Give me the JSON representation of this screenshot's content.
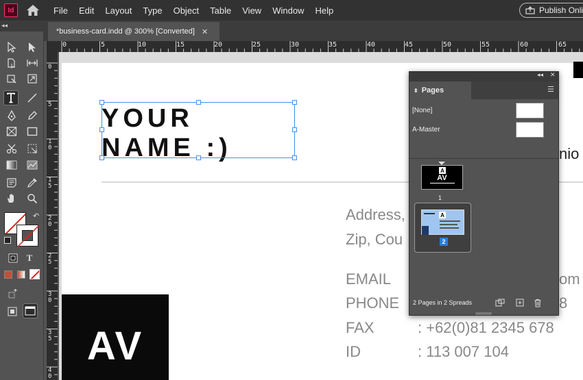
{
  "app": {
    "logo": "Id"
  },
  "menu": {
    "items": [
      "File",
      "Edit",
      "Layout",
      "Type",
      "Object",
      "Table",
      "View",
      "Window",
      "Help"
    ],
    "publish_label": "Publish Onlin"
  },
  "document": {
    "tab_title": "*business-card.indd @ 300% [Converted]",
    "tab_close": "✕"
  },
  "rulers": {
    "horizontal": [
      "0",
      "5",
      "10",
      "15",
      "20",
      "25",
      "30",
      "35",
      "40",
      "45",
      "50",
      "55",
      "60",
      "65"
    ],
    "vertical": [
      "0",
      "5",
      "10",
      "15",
      "20",
      "25",
      "30",
      "35",
      "40"
    ]
  },
  "card": {
    "name_line1": "YOUR",
    "name_line2": "NAME :)",
    "partial_right": "nio",
    "address1": "Address,",
    "address2": "Zip, Cou",
    "email_label": "EMAIL",
    "email_value": "om",
    "phone_label": "PHONE",
    "phone_value": "8",
    "fax_label": "FAX",
    "fax_value": ": +62(0)81 2345 678",
    "id_label": "ID",
    "id_value": ": 113 007 104",
    "logo_text": "AV"
  },
  "pages_panel": {
    "collapse": "◂◂",
    "close": "✕",
    "tab_label": "Pages",
    "masters": [
      {
        "label": "[None]"
      },
      {
        "label": "A-Master"
      }
    ],
    "page1": {
      "marker": "A",
      "thumb_text": "AV",
      "number": "1"
    },
    "page2": {
      "marker": "A",
      "number": "2"
    },
    "footer_text": "2 Pages in 2 Spreads"
  },
  "colors": {
    "menubar": "#323232",
    "selection": "#3f8ff0",
    "page_selected": "#2d7cd6"
  }
}
